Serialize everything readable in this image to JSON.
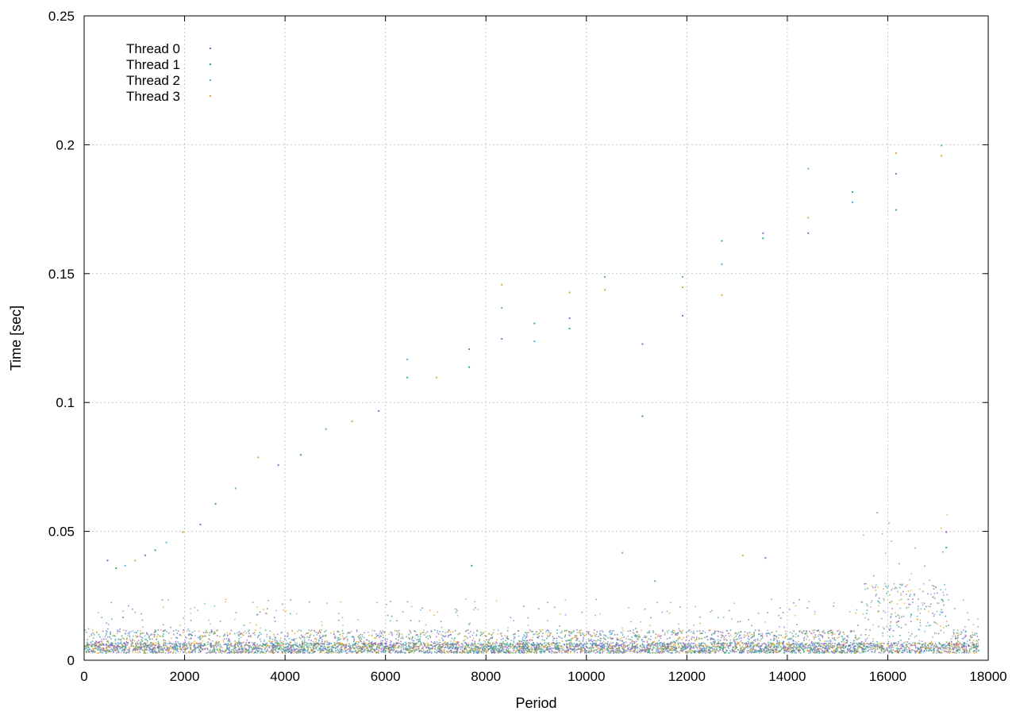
{
  "chart_data": {
    "type": "scatter",
    "title": "",
    "xlabel": "Period",
    "ylabel": "Time [sec]",
    "xlim": [
      0,
      18000
    ],
    "ylim": [
      0,
      0.25
    ],
    "x_ticks": [
      0,
      2000,
      4000,
      6000,
      8000,
      10000,
      12000,
      14000,
      16000,
      18000
    ],
    "x_tick_labels": [
      "0",
      "2000",
      "4000",
      "6000",
      "8000",
      "10000",
      "12000",
      "14000",
      "16000",
      "18000"
    ],
    "y_ticks": [
      0,
      0.05,
      0.1,
      0.15,
      0.2,
      0.25
    ],
    "y_tick_labels": [
      "0",
      "0.05",
      "0.1",
      "0.15",
      "0.2",
      "0.25"
    ],
    "grid": true,
    "legend_position": "top-left",
    "series": [
      {
        "name": "Thread 0",
        "color": "#8f52c8"
      },
      {
        "name": "Thread 1",
        "color": "#2a9e6e"
      },
      {
        "name": "Thread 2",
        "color": "#4fa3d6"
      },
      {
        "name": "Thread 3",
        "color": "#e0a020"
      }
    ],
    "baseline_band": {
      "x_start": 0,
      "x_end": 17800,
      "typical_y_low": 0.003,
      "typical_y_high": 0.012,
      "dense_center": 0.005,
      "upper_region_x": [
        15500,
        17200
      ],
      "upper_region_y_high": 0.03
    },
    "outlier_points": [
      {
        "x": 450,
        "y": 0.039
      },
      {
        "x": 620,
        "y": 0.036
      },
      {
        "x": 800,
        "y": 0.037
      },
      {
        "x": 1000,
        "y": 0.039
      },
      {
        "x": 1200,
        "y": 0.041
      },
      {
        "x": 1400,
        "y": 0.043
      },
      {
        "x": 1620,
        "y": 0.046
      },
      {
        "x": 1950,
        "y": 0.05
      },
      {
        "x": 2300,
        "y": 0.053
      },
      {
        "x": 2600,
        "y": 0.061
      },
      {
        "x": 3000,
        "y": 0.067
      },
      {
        "x": 3450,
        "y": 0.079
      },
      {
        "x": 3850,
        "y": 0.076
      },
      {
        "x": 4300,
        "y": 0.08
      },
      {
        "x": 4800,
        "y": 0.09
      },
      {
        "x": 5320,
        "y": 0.093
      },
      {
        "x": 5850,
        "y": 0.097
      },
      {
        "x": 6420,
        "y": 0.11
      },
      {
        "x": 6420,
        "y": 0.117
      },
      {
        "x": 7000,
        "y": 0.11
      },
      {
        "x": 7650,
        "y": 0.121
      },
      {
        "x": 7650,
        "y": 0.114
      },
      {
        "x": 8300,
        "y": 0.137
      },
      {
        "x": 8300,
        "y": 0.146
      },
      {
        "x": 8300,
        "y": 0.125
      },
      {
        "x": 8950,
        "y": 0.131
      },
      {
        "x": 8950,
        "y": 0.124
      },
      {
        "x": 9650,
        "y": 0.143
      },
      {
        "x": 9650,
        "y": 0.133
      },
      {
        "x": 9650,
        "y": 0.129
      },
      {
        "x": 10350,
        "y": 0.149
      },
      {
        "x": 10350,
        "y": 0.144
      },
      {
        "x": 11100,
        "y": 0.123
      },
      {
        "x": 11100,
        "y": 0.095
      },
      {
        "x": 11900,
        "y": 0.149
      },
      {
        "x": 11900,
        "y": 0.145
      },
      {
        "x": 11900,
        "y": 0.134
      },
      {
        "x": 12680,
        "y": 0.163
      },
      {
        "x": 12680,
        "y": 0.154
      },
      {
        "x": 12680,
        "y": 0.142
      },
      {
        "x": 13500,
        "y": 0.166
      },
      {
        "x": 13500,
        "y": 0.164
      },
      {
        "x": 14400,
        "y": 0.191
      },
      {
        "x": 14400,
        "y": 0.172
      },
      {
        "x": 14400,
        "y": 0.166
      },
      {
        "x": 15280,
        "y": 0.182
      },
      {
        "x": 15280,
        "y": 0.178
      },
      {
        "x": 16150,
        "y": 0.197
      },
      {
        "x": 16150,
        "y": 0.189
      },
      {
        "x": 16150,
        "y": 0.175
      },
      {
        "x": 17050,
        "y": 0.2
      },
      {
        "x": 17050,
        "y": 0.196
      },
      {
        "x": 17150,
        "y": 0.05
      },
      {
        "x": 17150,
        "y": 0.044
      },
      {
        "x": 10700,
        "y": 0.042
      },
      {
        "x": 13100,
        "y": 0.041
      },
      {
        "x": 13550,
        "y": 0.04
      },
      {
        "x": 7700,
        "y": 0.037
      },
      {
        "x": 11350,
        "y": 0.031
      }
    ]
  }
}
